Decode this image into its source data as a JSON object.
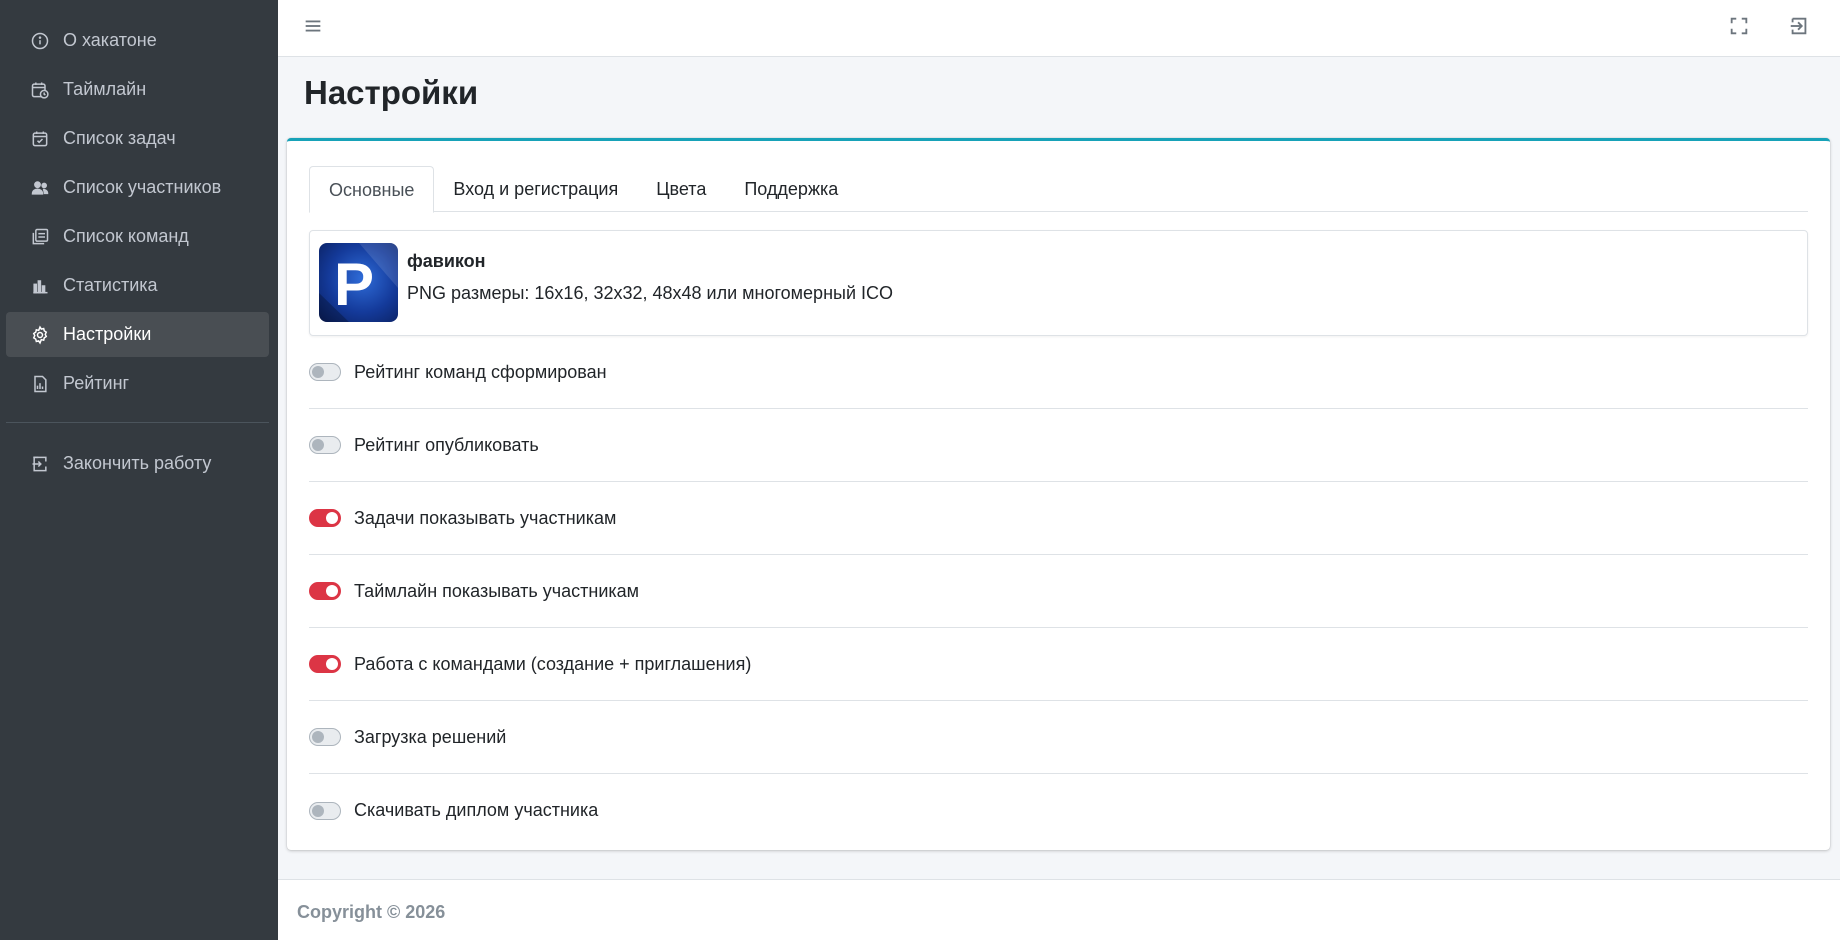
{
  "sidebar": {
    "items": [
      {
        "label": "О хакатоне",
        "icon": "info-icon"
      },
      {
        "label": "Таймлайн",
        "icon": "calendar-clock-icon"
      },
      {
        "label": "Список задач",
        "icon": "calendar-check-icon"
      },
      {
        "label": "Список участников",
        "icon": "users-icon"
      },
      {
        "label": "Список команд",
        "icon": "list-stack-icon"
      },
      {
        "label": "Статистика",
        "icon": "bar-chart-icon"
      },
      {
        "label": "Настройки",
        "icon": "gear-icon",
        "active": true
      },
      {
        "label": "Рейтинг",
        "icon": "report-icon"
      }
    ],
    "logout_label": "Закончить работу"
  },
  "topbar": {
    "menu_icon": "hamburger-icon",
    "fullscreen_icon": "fullscreen-icon",
    "logout_icon": "logout-icon"
  },
  "page": {
    "title": "Настройки"
  },
  "tabs": [
    {
      "label": "Основные",
      "active": true
    },
    {
      "label": "Вход и регистрация"
    },
    {
      "label": "Цвета"
    },
    {
      "label": "Поддержка"
    }
  ],
  "favicon": {
    "title": "фавикон",
    "description": "PNG размеры: 16x16, 32x32, 48x48 или многомерный ICO",
    "letter": "P"
  },
  "toggles": [
    {
      "label": "Рейтинг команд сформирован",
      "on": false
    },
    {
      "label": "Рейтинг опубликовать",
      "on": false
    },
    {
      "label": "Задачи показывать участникам",
      "on": true
    },
    {
      "label": "Таймлайн показывать участникам",
      "on": true
    },
    {
      "label": "Работа с командами (создание + приглашения)",
      "on": true
    },
    {
      "label": "Загрузка решений",
      "on": false
    },
    {
      "label": "Скачивать диплом участника",
      "on": false
    }
  ],
  "footer": {
    "copyright": "Copyright © 2026"
  },
  "colors": {
    "sidebar_bg": "#343a40",
    "accent_card": "#17a2b8",
    "switch_on": "#dc3545"
  }
}
